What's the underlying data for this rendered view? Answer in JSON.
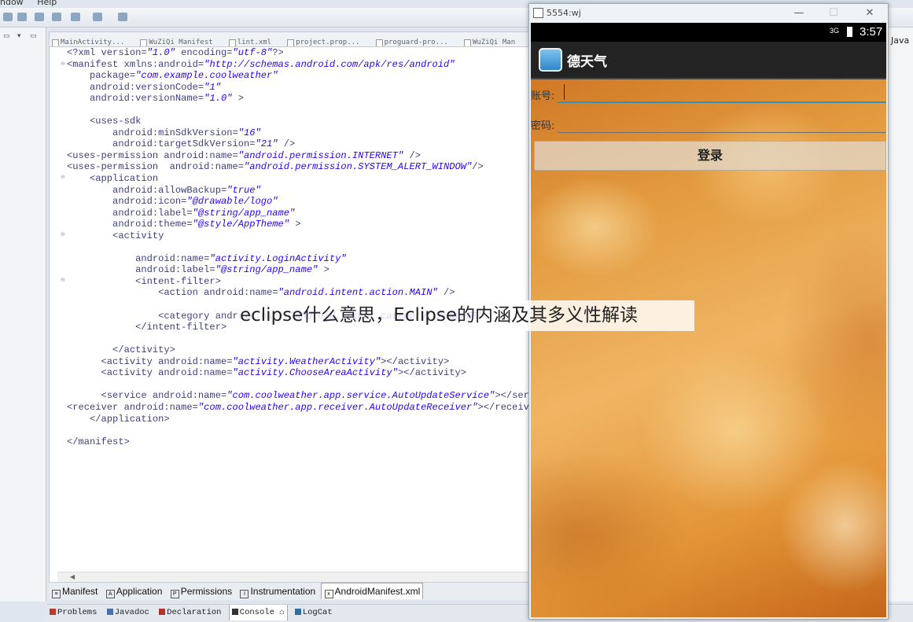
{
  "menu": [
    "ndow",
    "Help"
  ],
  "editor": {
    "tabs": [
      "MainActivity...",
      "WuZiQi Manifest",
      "lint.xml",
      "project.prop...",
      "proguard-pro...",
      "WuZiQi Man"
    ],
    "code_lines": [
      "<?xml version=\"1.0\" encoding=\"utf-8\"?>",
      "<manifest xmlns:android=\"http://schemas.android.com/apk/res/android\"",
      "    package=\"com.example.coolweather\"",
      "    android:versionCode=\"1\"",
      "    android:versionName=\"1.0\" >",
      "",
      "    <uses-sdk",
      "        android:minSdkVersion=\"16\"",
      "        android:targetSdkVersion=\"21\" />",
      "<uses-permission android:name=\"android.permission.INTERNET\" />",
      "<uses-permission  android:name=\"android.permission.SYSTEM_ALERT_WINDOW\"/>",
      "    <application",
      "        android:allowBackup=\"true\"",
      "        android:icon=\"@drawable/logo\"",
      "        android:label=\"@string/app_name\"",
      "        android:theme=\"@style/AppTheme\" >",
      "        <activity",
      "",
      "            android:name=\"activity.LoginActivity\"",
      "            android:label=\"@string/app_name\" >",
      "            <intent-filter>",
      "                <action android:name=\"android.intent.action.MAIN\" />",
      "",
      "                <category android:name=\"android.intent.category.LAUNCHER\" />",
      "            </intent-filter>",
      "",
      "        </activity>",
      "      <activity android:name=\"activity.WeatherActivity\"></activity>",
      "      <activity android:name=\"activity.ChooseAreaActivity\"></activity>",
      "",
      "      <service android:name=\"com.coolweather.app.service.AutoUpdateService\"></service>",
      "<receiver android:name=\"com.coolweather.app.receiver.AutoUpdateReceiver\"></receiver>",
      "    </application>",
      "",
      "</manifest>"
    ]
  },
  "editor_tabs": [
    {
      "icon": "≡",
      "label": "Manifest"
    },
    {
      "icon": "A",
      "label": "Application"
    },
    {
      "icon": "P",
      "label": "Permissions"
    },
    {
      "icon": "I",
      "label": "Instrumentation"
    },
    {
      "icon": "x",
      "label": "AndroidManifest.xml",
      "active": true
    }
  ],
  "view_tabs": [
    {
      "label": "Problems",
      "color": "#c0392b"
    },
    {
      "label": "Javadoc",
      "color": "#4a70a8"
    },
    {
      "label": "Declaration",
      "color": "#b0342c"
    },
    {
      "label": "Console ⌂",
      "color": "#333333",
      "active": true
    },
    {
      "label": "LogCat",
      "color": "#2f6fa5"
    }
  ],
  "right_perspective": "Java",
  "emulator": {
    "window_title": "5554:wj",
    "status": {
      "signal": "3G",
      "time": "3:57"
    },
    "app_title": "德天气",
    "account_label": "账号:",
    "password_label": "密码:",
    "login_button": "登录"
  },
  "caption": "eclipse什么意思，Eclipse的内涵及其多义性解读"
}
